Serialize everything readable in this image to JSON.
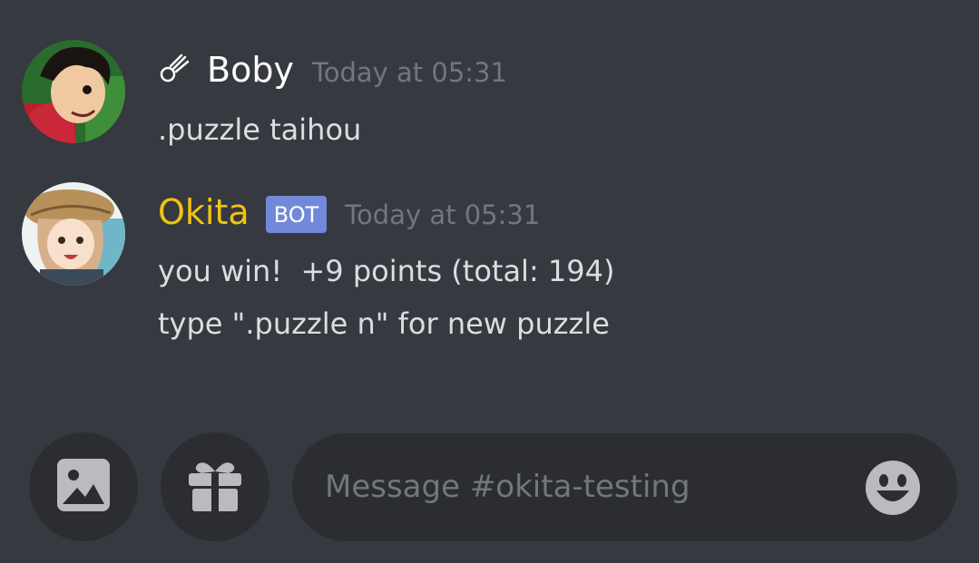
{
  "messages": [
    {
      "author": "Boby",
      "author_color": "#ffffff",
      "badge_icon": "comet-icon",
      "timestamp": "Today at 05:31",
      "lines": [
        ".puzzle taihou"
      ]
    },
    {
      "author": "Okita",
      "author_color": "#f1c40f",
      "bot_tag": "BOT",
      "timestamp": "Today at 05:31",
      "lines": [
        "you win!  +9 points (total: 194)",
        "type \".puzzle n\" for new puzzle"
      ]
    }
  ],
  "composer": {
    "placeholder": "Message #okita-testing",
    "buttons": [
      "image-icon",
      "gift-icon",
      "emoji-icon"
    ]
  },
  "colors": {
    "background": "#36393f",
    "input_background": "#2b2d31",
    "muted_text": "#72767d",
    "bot_tag": "#7289da"
  }
}
